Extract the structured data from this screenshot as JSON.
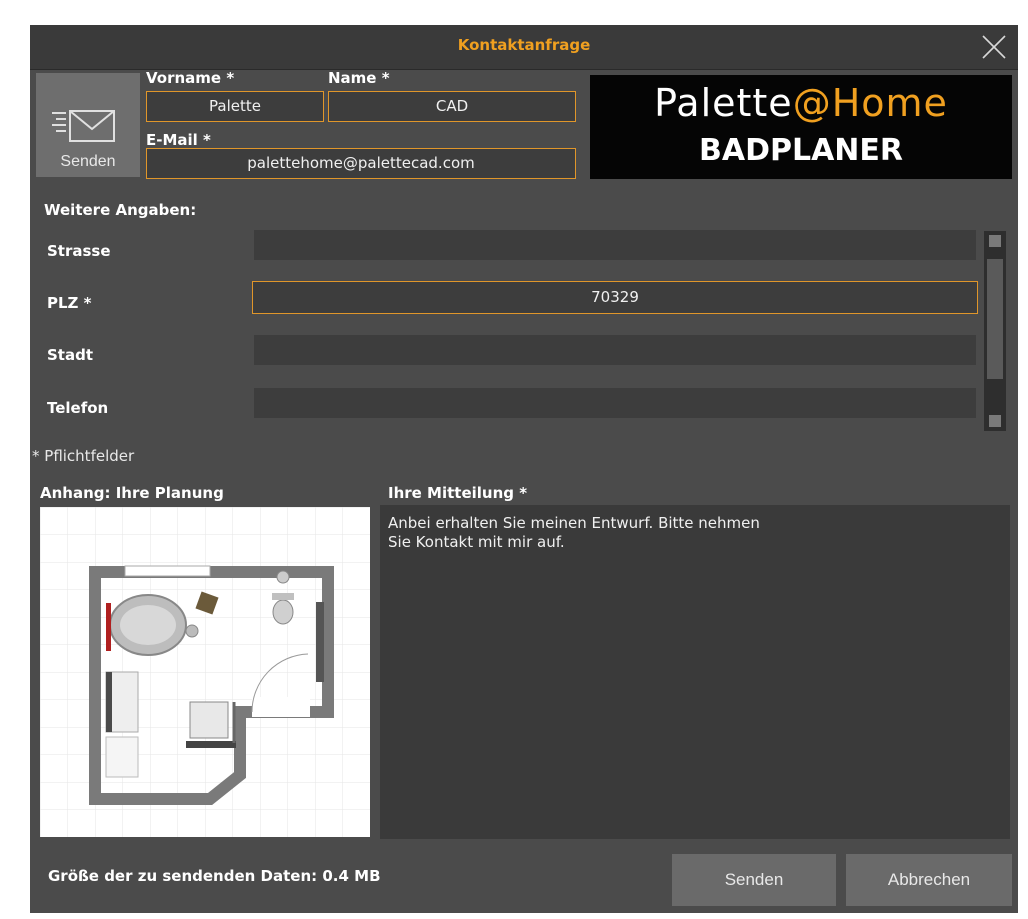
{
  "dialog": {
    "title": "Kontaktanfrage"
  },
  "send_tile": {
    "label": "Senden",
    "icon": "envelope-send-icon"
  },
  "form": {
    "vorname_label": "Vorname *",
    "vorname_value": "Palette",
    "name_label": "Name *",
    "name_value": "CAD",
    "email_label": "E-Mail *",
    "email_value": "palettehome@palettecad.com"
  },
  "logo": {
    "line1_part1": "Palette",
    "line1_part2": "@Home",
    "line2": "BADPLANER"
  },
  "more": {
    "heading": "Weitere Angaben:",
    "strasse_label": "Strasse",
    "strasse_value": "",
    "plz_label": "PLZ *",
    "plz_value": "70329",
    "stadt_label": "Stadt",
    "stadt_value": "",
    "telefon_label": "Telefon",
    "telefon_value": ""
  },
  "pflicht_note": "* Pflichtfelder",
  "attachment": {
    "heading": "Anhang: Ihre Planung"
  },
  "message": {
    "heading": "Ihre Mitteilung *",
    "line1": "Anbei erhalten Sie meinen Entwurf. Bitte nehmen",
    "line2": "Sie Kontakt mit mir auf."
  },
  "footer": {
    "size_text": "Größe der zu sendenden Daten: 0.4 MB",
    "send_button": "Senden",
    "cancel_button": "Abbrechen"
  },
  "colors": {
    "accent": "#f0a020",
    "field_border": "#e0962a",
    "panel": "#4b4b4b"
  }
}
